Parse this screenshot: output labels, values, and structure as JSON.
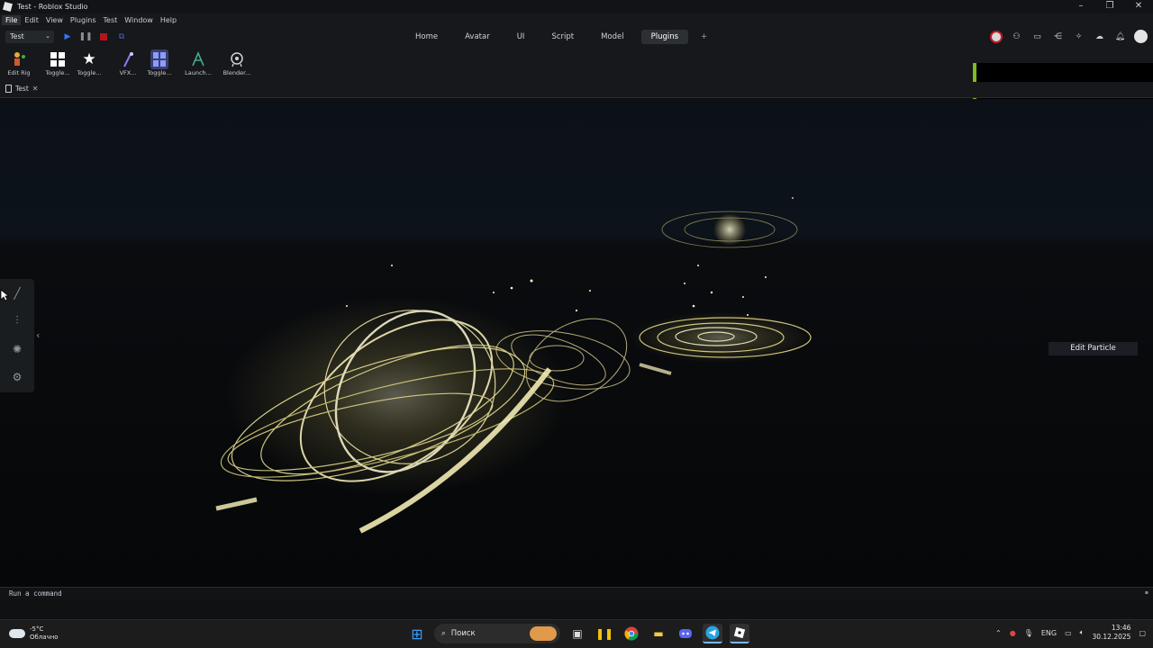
{
  "window": {
    "title": "Test - Roblox Studio"
  },
  "menu": [
    "File",
    "Edit",
    "View",
    "Plugins",
    "Test",
    "Window",
    "Help"
  ],
  "mode_select": {
    "value": "Test"
  },
  "tabs": [
    {
      "label": "Home"
    },
    {
      "label": "Avatar"
    },
    {
      "label": "UI"
    },
    {
      "label": "Script"
    },
    {
      "label": "Model"
    },
    {
      "label": "Plugins"
    }
  ],
  "ribbon": [
    {
      "label": "Edit Rig"
    },
    {
      "label": "Toggle..."
    },
    {
      "label": "Toggle..."
    },
    {
      "label": "VFX..."
    },
    {
      "label": "Toggle..."
    },
    {
      "label": "Launch..."
    },
    {
      "label": "Blender..."
    }
  ],
  "document_tab": {
    "label": "Test"
  },
  "viewport": {
    "edit_particle_label": "Edit Particle"
  },
  "command_bar": {
    "placeholder": "Run a command"
  },
  "taskbar": {
    "weather_temp": "-5°C",
    "weather_desc": "Облачно",
    "search_label": "Поиск",
    "language": "ENG",
    "time": "13:46",
    "date": "30.12.2025"
  }
}
